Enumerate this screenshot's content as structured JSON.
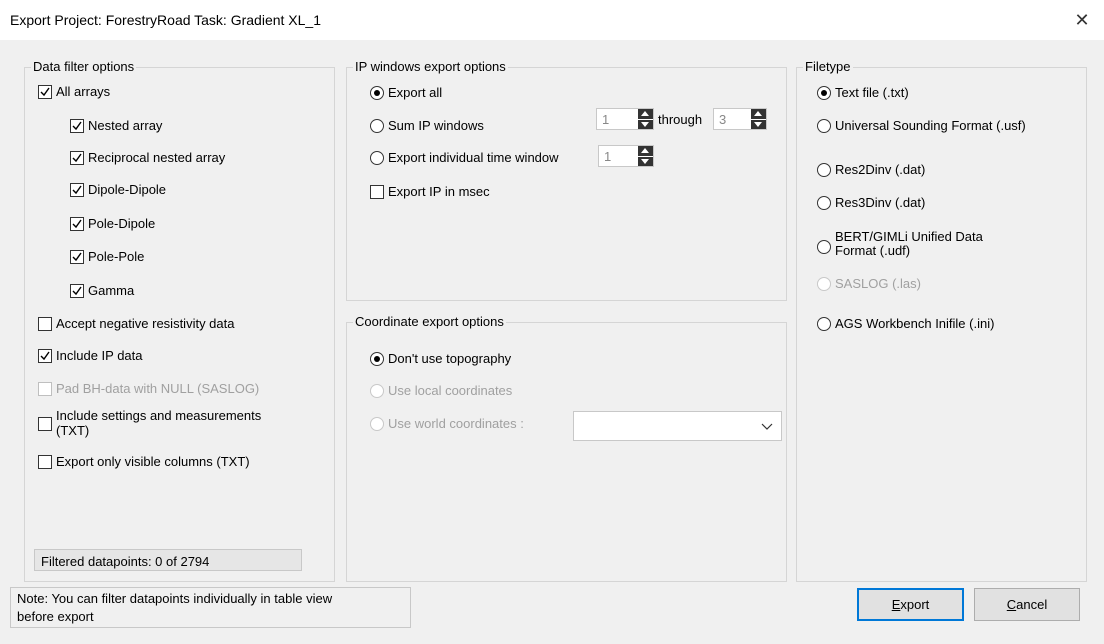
{
  "window": {
    "title": "Export Project: ForestryRoad Task: Gradient XL_1",
    "close_icon": "close-icon"
  },
  "data_filter": {
    "legend": "Data filter options",
    "all_arrays": {
      "label": "All arrays",
      "checked": true
    },
    "arrays": [
      {
        "label": "Nested array",
        "checked": true
      },
      {
        "label": "Reciprocal nested array",
        "checked": true
      },
      {
        "label": "Dipole-Dipole",
        "checked": true
      },
      {
        "label": "Pole-Dipole",
        "checked": true
      },
      {
        "label": "Pole-Pole",
        "checked": true
      },
      {
        "label": "Gamma",
        "checked": true
      }
    ],
    "accept_negative": {
      "label": "Accept negative resistivity data",
      "checked": false
    },
    "include_ip": {
      "label": "Include IP data",
      "checked": true
    },
    "pad_bh": {
      "label": "Pad BH-data with NULL (SASLOG)",
      "checked": false,
      "disabled": true
    },
    "include_settings": {
      "label_line1": "Include settings and measurements",
      "label_line2": "(TXT)",
      "checked": false
    },
    "visible_columns": {
      "label": "Export only visible columns (TXT)",
      "checked": false
    },
    "filtered_status": "Filtered datapoints: 0 of 2794"
  },
  "ip_windows": {
    "legend": "IP windows export options",
    "export_all": "Export all",
    "sum_ip": "Sum IP windows",
    "sum_from": "1",
    "through_label": "through",
    "sum_to": "3",
    "export_individual": "Export individual time window",
    "individual_value": "1",
    "export_msec": "Export IP in msec"
  },
  "coordinates": {
    "legend": "Coordinate export options",
    "dont_use_topo": "Don't use topography",
    "use_local": "Use local coordinates",
    "use_world": "Use world coordinates :",
    "world_select_value": ""
  },
  "filetype": {
    "legend": "Filetype",
    "options": [
      {
        "label": "Text file (.txt)",
        "selected": true
      },
      {
        "label": "Universal Sounding Format (.usf)"
      },
      {
        "label": "Res2Dinv (.dat)"
      },
      {
        "label": "Res3Dinv (.dat)"
      },
      {
        "label": "BERT/GIMLi Unified Data",
        "label2": "Format (.udf)"
      },
      {
        "label": "SASLOG (.las)",
        "disabled": true
      },
      {
        "label": "AGS Workbench Inifile (.ini)"
      }
    ]
  },
  "note": {
    "line1": "Note: You can filter datapoints individually in table view",
    "line2": "before export"
  },
  "buttons": {
    "export_first": "E",
    "export_rest": "xport",
    "cancel_first": "C",
    "cancel_rest": "ancel"
  }
}
